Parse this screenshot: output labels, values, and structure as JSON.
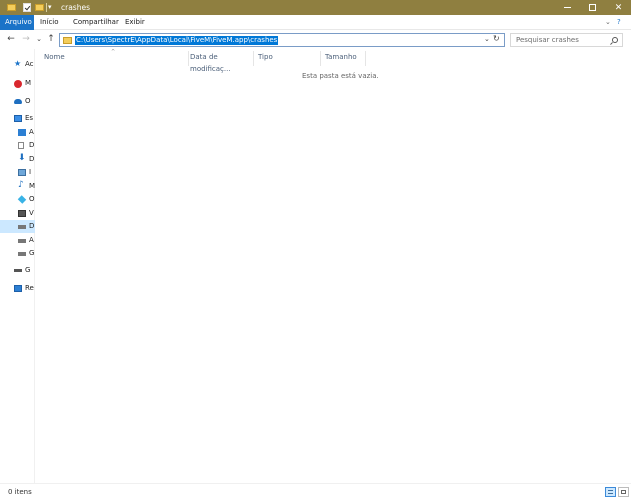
{
  "window": {
    "title": "crashes",
    "controls": {
      "minimize": "–",
      "maximize": "☐",
      "close": "✕"
    }
  },
  "ribbon": {
    "tabs": [
      "Arquivo",
      "Início",
      "Compartilhar",
      "Exibir"
    ],
    "expand_glyph": "⌄",
    "help_glyph": "?"
  },
  "navigation": {
    "back": "←",
    "forward": "→",
    "recent": "⌄",
    "up": "↑"
  },
  "address_bar": {
    "path": "C:\\Users\\SpectrE\\AppData\\Local\\FiveM\\FiveM.app\\crashes",
    "dropdown_glyph": "⌄",
    "refresh_glyph": "↻"
  },
  "search": {
    "placeholder": "Pesquisar crashes"
  },
  "nav_pane": {
    "items": [
      {
        "label": "Ac",
        "icon": "star-icon"
      },
      {
        "label": "M",
        "icon": "mega-icon"
      },
      {
        "label": "O",
        "icon": "cloud-icon"
      },
      {
        "label": "Es",
        "icon": "pc-icon"
      },
      {
        "label": "A",
        "icon": "desktop-icon"
      },
      {
        "label": "D",
        "icon": "document-icon"
      },
      {
        "label": "D",
        "icon": "download-icon"
      },
      {
        "label": "I",
        "icon": "picture-icon"
      },
      {
        "label": "M",
        "icon": "music-icon"
      },
      {
        "label": "O",
        "icon": "objects-icon"
      },
      {
        "label": "V",
        "icon": "video-icon"
      },
      {
        "label": "D",
        "icon": "drive-icon"
      },
      {
        "label": "A",
        "icon": "drive-icon"
      },
      {
        "label": "G",
        "icon": "drive-icon"
      },
      {
        "label": "G",
        "icon": "drive-icon"
      },
      {
        "label": "Re",
        "icon": "network-icon"
      }
    ]
  },
  "file_list": {
    "columns": [
      "Nome",
      "Data de modificaç...",
      "Tipo",
      "Tamanho"
    ],
    "sort_glyph": "^",
    "empty_message": "Esta pasta está vazia."
  },
  "status_bar": {
    "item_count": "0 itens"
  },
  "colors": {
    "titlebar": "#8f7f40",
    "file_tab": "#1a73c8",
    "selection": "#0078d7",
    "selected_nav": "#cce8ff"
  }
}
